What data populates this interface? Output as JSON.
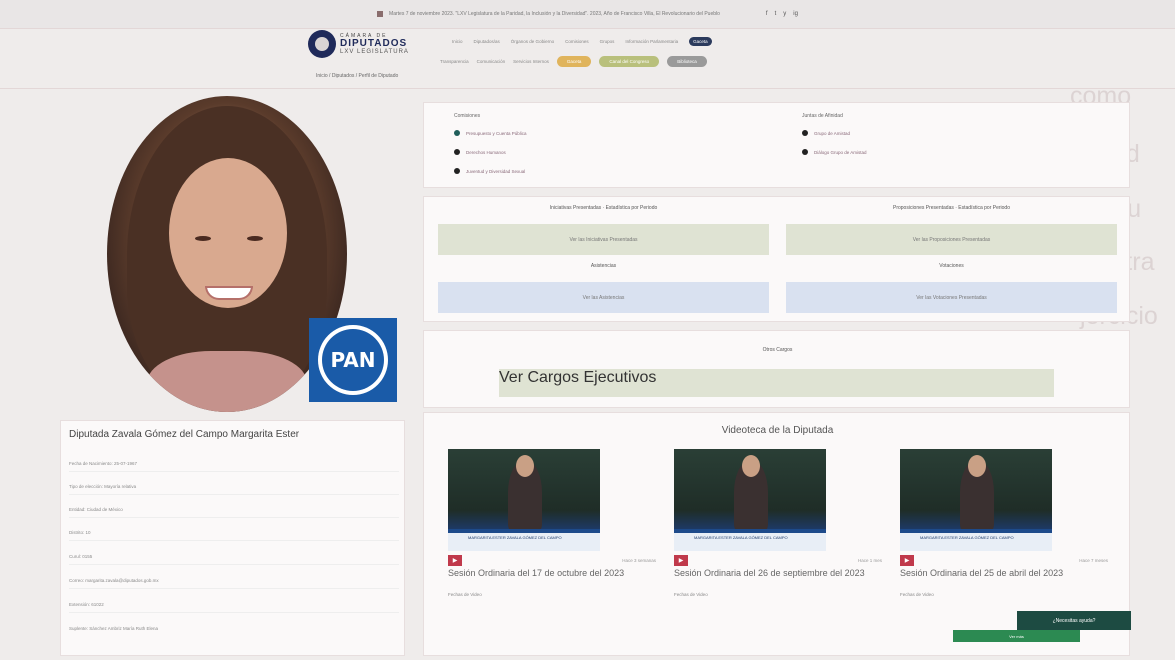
{
  "topbar": {
    "text": "Martes 7 de noviembre 2023. \"LXV Legislatura de la Paridad, la Inclusión y la Diversidad\". 2023, Año de Francisco Villa, El Revolucionario del Pueblo",
    "social": [
      "f",
      "t",
      "y",
      "ig"
    ]
  },
  "header": {
    "logo_top": "CÁMARA DE",
    "logo_main": "DIPUTADOS",
    "logo_sub": "LXV LEGISLATURA",
    "nav_primary": [
      "Inicio",
      "Diputados/as",
      "Órganos de Gobierno",
      "Comisiones",
      "Grupos",
      "Información Parlamentaria"
    ],
    "nav_primary_pill": "Gaceta",
    "nav_secondary": [
      "Transparencia",
      "Comunicación",
      "Servicios Internos"
    ],
    "nav_pills": [
      "Gaceta",
      "Canal del Congreso",
      "Biblioteca"
    ],
    "breadcrumb": "Inicio / Diputados / Perfil de Diputado"
  },
  "profile": {
    "name": "Diputada Zavala Gómez del Campo Margarita Ester",
    "rows": [
      "Fecha de Nacimiento: 25-07-1967",
      "Tipo de elección: Mayoría relativa",
      "Entidad: Ciudad de México",
      "Distrito: 10",
      "Curul: 0155",
      "Correo: margarita.zavala@diputados.gob.mx",
      "Extensión: 61022",
      "Suplente: Sánchez Ambriz María Ruth Elena"
    ],
    "party": "PAN"
  },
  "comisiones": {
    "title_left": "Comisiones",
    "title_right": "Juntas de Afinidad",
    "left": [
      {
        "label": "Presupuesto y Cuenta Pública",
        "color": "#1f5e5a"
      },
      {
        "label": "Derechos Humanos",
        "color": "#222222"
      },
      {
        "label": "Juventud y Diversidad Sexual",
        "color": "#222222"
      }
    ],
    "right": [
      {
        "label": "Grupo de Amistad",
        "color": "#222222"
      },
      {
        "label": "Diálogo Grupo de Amistad",
        "color": "#222222"
      }
    ]
  },
  "actividad": {
    "iniciativas_title": "Iniciativas Presentadas · Estadística por Periodo",
    "iniciativas_button": "Ver las Iniciativas Presentadas",
    "proposiciones_title": "Proposiciones Presentadas · Estadística por Periodo",
    "proposiciones_button": "Ver las Proposiciones Presentadas",
    "asistencias_title": "Asistencias",
    "asistencias_button": "Ver las Asistencias",
    "votaciones_title": "Votaciones",
    "votaciones_button": "Ver las Votaciones Presentadas"
  },
  "cargos": {
    "title": "Otros Cargos",
    "button": "Ver Cargos Ejecutivos"
  },
  "videoteca": {
    "title": "Videoteca de la Diputada",
    "videos": [
      {
        "date": "Hace 3 semanas",
        "title": "Sesión Ordinaria del 17 de octubre del 2023",
        "caption": "MARGARITA ESTER ZAVALA GÓMEZ DEL CAMPO",
        "publisher": "Fechas de Video"
      },
      {
        "date": "Hace 1 mes",
        "title": "Sesión Ordinaria del 26 de septiembre del 2023",
        "caption": "MARGARITA ESTER ZAVALA GÓMEZ DEL CAMPO",
        "publisher": "Fechas de Video"
      },
      {
        "date": "Hace 7 meses",
        "title": "Sesión Ordinaria del 25 de abril del 2023",
        "caption": "MARGARITA ESTER ZAVALA GÓMEZ DEL CAMPO",
        "publisher": "Fechas de Video"
      }
    ]
  },
  "help": {
    "label": "¿Necesitas ayuda?",
    "bar": "Ver más"
  },
  "colors": {
    "pan_blue": "#1a5ba8",
    "help_green": "#1d4b42",
    "play_red": "#c0394b"
  }
}
